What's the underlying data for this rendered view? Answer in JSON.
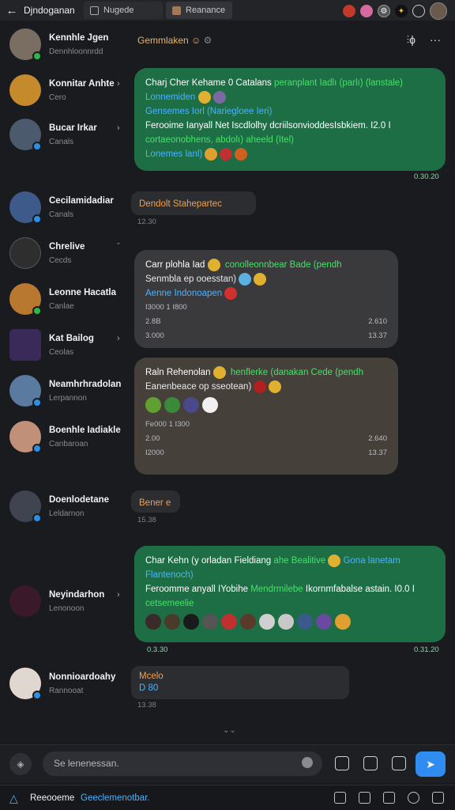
{
  "topbar": {
    "back_icon": "arrow-left-icon",
    "app_title": "Djndoganan",
    "tabs": [
      {
        "label": "Nugede",
        "icon": "page-icon"
      },
      {
        "label": "Reanance",
        "icon": "folder-icon"
      }
    ],
    "right_icons": [
      "red-emoji-icon",
      "pink-emoji-icon",
      "gear-icon",
      "dark-emoji-icon",
      "search-icon"
    ]
  },
  "sidebar": {
    "contacts": [
      {
        "name": "Kennhle Jgen",
        "sub": "Dennhloonnrdd",
        "color": "#7a6d62",
        "badge": "green",
        "chevron": ""
      },
      {
        "name": "Konnitar Anhte",
        "sub": "Cero",
        "color": "#c48a2c",
        "badge": "",
        "chevron": "›"
      },
      {
        "name": "Bucar Irkar",
        "sub": "Canals",
        "color": "#4c5a6e",
        "badge": "blue",
        "chevron": "›"
      },
      {
        "name": "Cecilamidadiar",
        "sub": "Canals",
        "color": "#3e5a8a",
        "badge": "blue",
        "chevron": ""
      },
      {
        "name": "Chrelive",
        "sub": "Cecds",
        "color": "#2e2e2e",
        "badge": "",
        "chevron": "ˇ"
      },
      {
        "name": "Leonne Hacatla",
        "sub": "Canlae",
        "color": "#b87830",
        "badge": "green",
        "chevron": ""
      },
      {
        "name": "Kat Bailog",
        "sub": "Ceolas",
        "color": "#3a2a5a",
        "badge": "",
        "chevron": "›"
      },
      {
        "name": "Neamhrhradolan",
        "sub": "Lerpannon",
        "color": "#5a7aa0",
        "badge": "blue",
        "chevron": ""
      },
      {
        "name": "Boenhle Iadiakle",
        "sub": "Canbaroan",
        "color": "#c09078",
        "badge": "blue",
        "chevron": ""
      },
      {
        "name": "Doenlodetane",
        "sub": "Leldarnon",
        "color": "#3e4450",
        "badge": "blue",
        "chevron": ""
      },
      {
        "name": "Neyindarhon",
        "sub": "Lenonoon",
        "color": "#3a1a2a",
        "badge": "",
        "chevron": "›"
      },
      {
        "name": "Nonnioardoahy",
        "sub": "Rannooat",
        "color": "#e0d8d0",
        "badge": "blue",
        "chevron": ""
      }
    ]
  },
  "chat_header": {
    "title": "Gemmlaken",
    "actions": [
      "pin-icon",
      "more-icon"
    ],
    "pin_label": "⫶ϕ",
    "more_label": "···"
  },
  "messages": {
    "m1": {
      "line1": "Charj Cher Kehame 0 Catalans",
      "line1b": "peranplant Iadlı (parlı) (lanstale)",
      "line2": "Lonnemiden",
      "line3": "Gensemes Iorl (Nariegloee Ieri)",
      "line4": "Ferooime Ianyall Net Iscdlolhy dcriilsonvioddesIsbkiem. I2.0 I",
      "line5": "cortaeonobhens, abdolı) aheeld (Itel)",
      "line6": "Lonemes lanl)",
      "time": "0.30.20"
    },
    "m2": {
      "text": "Dendolt Stahepartec",
      "time": "12.30"
    },
    "m3": {
      "line1": "Carr plohla Iad",
      "line1b": "conolleonnbear Bade (pendh",
      "line2": "Senmbla ep ooesstan)",
      "line3": "Aenne Indonoapen",
      "line4": "I3000 1 I800",
      "line5a": "2.8B",
      "line5b": "2.610",
      "line6a": "3.000",
      "line6b": "13.37",
      "time": "13.37"
    },
    "m4": {
      "line1": "Raln Rehenolan",
      "line1b": "henflerke (danakan Cede (pendh",
      "line2": "Eanenbeace op sseotean)",
      "line4": "Fe000 1 I300",
      "line5a": "2.00",
      "line5b": "2.640",
      "line6a": "I2000",
      "line6b": "13.37",
      "time": "13.37"
    },
    "m5": {
      "text": "Bener e",
      "time": "15.38"
    },
    "m6": {
      "line1": "Char Kehn (y orladan Fieldiang",
      "line1b": "ahe Bealitive",
      "line1c": "Gona lanetam",
      "line2": "Flantenoch)",
      "line3": "Feroomme anyall IYobihe",
      "line3b": "Mendrmilebe",
      "line3c": "Ikornmfabalse astain. I0.0 I",
      "line4": "cetsemeelie",
      "time_left": "0.3.30",
      "time_right": "0.31.20"
    },
    "m7": {
      "title": "Mcelo",
      "text": "D 80",
      "time": "13.38"
    }
  },
  "composer": {
    "placeholder": "Se lenenessan.",
    "left_icon": "shield-icon",
    "tools": [
      "sticker-icon",
      "clipboard-icon",
      "image-icon"
    ],
    "send_icon": "send-icon",
    "send_glyph": "➤"
  },
  "bottombar": {
    "logo_icon": "triangle-logo-icon",
    "label1": "Reeooeme",
    "label2": "Geeclemenotbar.",
    "icons": [
      "export-icon",
      "grid-icon",
      "archive-icon",
      "settings-icon",
      "home-icon"
    ]
  },
  "colors": {
    "bg": "#1a1b1f",
    "green_bubble": "#1d6e45",
    "accent_green": "#48e06b",
    "accent_blue": "#4ab2ff",
    "send": "#2f8cf0"
  }
}
